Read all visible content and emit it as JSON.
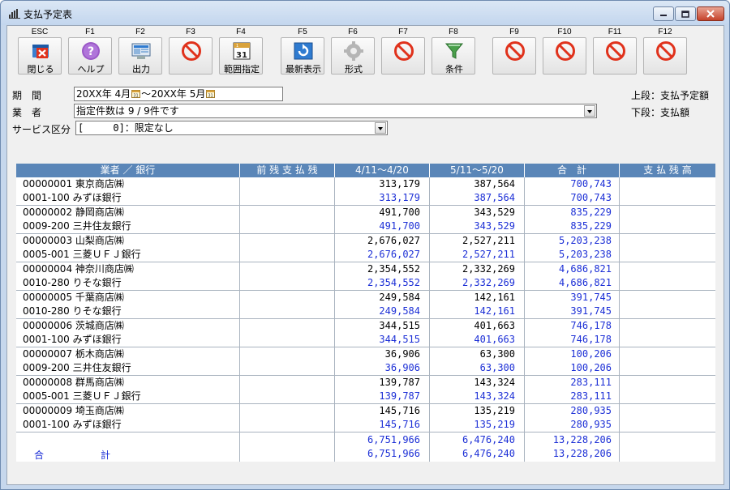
{
  "window": {
    "title": "支払予定表"
  },
  "toolbar": {
    "keys": [
      {
        "key": "ESC",
        "label": "閉じる",
        "icon": "close-app-icon"
      },
      {
        "key": "F1",
        "label": "ヘルプ",
        "icon": "help-icon"
      },
      {
        "key": "F2",
        "label": "出力",
        "icon": "output-icon"
      },
      {
        "key": "F3",
        "label": "",
        "icon": "disabled-icon"
      },
      {
        "key": "F4",
        "label": "範囲指定",
        "icon": "calendar-icon"
      },
      {
        "key": "F5",
        "label": "最新表示",
        "icon": "refresh-icon"
      },
      {
        "key": "F6",
        "label": "形式",
        "icon": "gear-icon"
      },
      {
        "key": "F7",
        "label": "",
        "icon": "disabled-icon"
      },
      {
        "key": "F8",
        "label": "条件",
        "icon": "filter-icon"
      },
      {
        "key": "F9",
        "label": "",
        "icon": "disabled-icon"
      },
      {
        "key": "F10",
        "label": "",
        "icon": "disabled-icon"
      },
      {
        "key": "F11",
        "label": "",
        "icon": "disabled-icon"
      },
      {
        "key": "F12",
        "label": "",
        "icon": "disabled-icon"
      }
    ]
  },
  "form": {
    "period_label": "期　間",
    "period_from": "20XX年 4月",
    "period_sep": "～",
    "period_to": "20XX年 5月",
    "vendor_label": "業　者",
    "vendor_value": "指定件数は 9 / 9件です",
    "service_label": "サービス区分",
    "service_value": "[     0]：限定なし",
    "legend_top": "上段：支払予定額",
    "legend_bottom": "下段：支払額"
  },
  "table": {
    "headers": [
      "業者 ／ 銀行",
      "前 残 支 払 残",
      "4/11～4/20",
      "5/11～5/20",
      "合　計",
      "支 払 残 高"
    ],
    "rows": [
      {
        "vendor": "00000001 東京商店㈱",
        "bank": "0001-100 みずほ銀行",
        "p1": "313,179",
        "p2": "387,564",
        "total": "700,743",
        "a1": "313,179",
        "a2": "387,564",
        "atotal": "700,743"
      },
      {
        "vendor": "00000002 静岡商店㈱",
        "bank": "0009-200 三井住友銀行",
        "p1": "491,700",
        "p2": "343,529",
        "total": "835,229",
        "a1": "491,700",
        "a2": "343,529",
        "atotal": "835,229"
      },
      {
        "vendor": "00000003 山梨商店㈱",
        "bank": "0005-001 三菱ＵＦＪ銀行",
        "p1": "2,676,027",
        "p2": "2,527,211",
        "total": "5,203,238",
        "a1": "2,676,027",
        "a2": "2,527,211",
        "atotal": "5,203,238"
      },
      {
        "vendor": "00000004 神奈川商店㈱",
        "bank": "0010-280 りそな銀行",
        "p1": "2,354,552",
        "p2": "2,332,269",
        "total": "4,686,821",
        "a1": "2,354,552",
        "a2": "2,332,269",
        "atotal": "4,686,821"
      },
      {
        "vendor": "00000005 千葉商店㈱",
        "bank": "0010-280 りそな銀行",
        "p1": "249,584",
        "p2": "142,161",
        "total": "391,745",
        "a1": "249,584",
        "a2": "142,161",
        "atotal": "391,745"
      },
      {
        "vendor": "00000006 茨城商店㈱",
        "bank": "0001-100 みずほ銀行",
        "p1": "344,515",
        "p2": "401,663",
        "total": "746,178",
        "a1": "344,515",
        "a2": "401,663",
        "atotal": "746,178"
      },
      {
        "vendor": "00000007 栃木商店㈱",
        "bank": "0009-200 三井住友銀行",
        "p1": "36,906",
        "p2": "63,300",
        "total": "100,206",
        "a1": "36,906",
        "a2": "63,300",
        "atotal": "100,206"
      },
      {
        "vendor": "00000008 群馬商店㈱",
        "bank": "0005-001 三菱ＵＦＪ銀行",
        "p1": "139,787",
        "p2": "143,324",
        "total": "283,111",
        "a1": "139,787",
        "a2": "143,324",
        "atotal": "283,111"
      },
      {
        "vendor": "00000009 埼玉商店㈱",
        "bank": "0001-100 みずほ銀行",
        "p1": "145,716",
        "p2": "135,219",
        "total": "280,935",
        "a1": "145,716",
        "a2": "135,219",
        "atotal": "280,935"
      }
    ],
    "totals": {
      "label_left": "合",
      "label_right": "計",
      "p1": "6,751,966",
      "p2": "6,476,240",
      "total": "13,228,206",
      "a1": "6,751,966",
      "a2": "6,476,240",
      "atotal": "13,228,206"
    }
  },
  "colors": {
    "header_bg": "#5a86b8",
    "actual_text": "#1c2fd6",
    "disabled_red": "#e0321c"
  }
}
